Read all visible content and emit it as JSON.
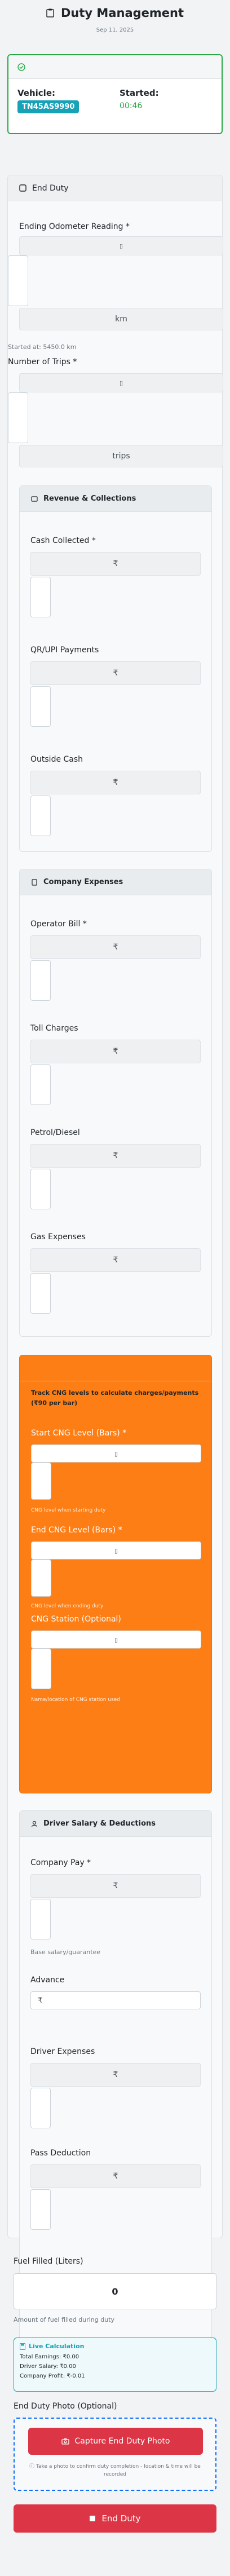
{
  "header": {
    "title": "Duty Management",
    "date": "Sep 11, 2025"
  },
  "vehicle_card": {
    "vehicle_label": "Vehicle:",
    "vehicle_value": "TN45AS9990",
    "started_label": "Started:",
    "started_value": "00:46"
  },
  "end_duty": {
    "title": "End Duty",
    "odometer_label": "Ending Odometer Reading *",
    "odometer_unit": "km",
    "odometer_hint": "Started at: 5450.0 km",
    "trips_label": "Number of Trips *",
    "trips_unit": "trips"
  },
  "revenue": {
    "title": "Revenue & Collections",
    "currency": "₹",
    "cash_label": "Cash Collected *",
    "qr_label": "QR/UPI Payments",
    "outside_label": "Outside Cash"
  },
  "expenses": {
    "title": "Company Expenses",
    "currency": "₹",
    "operator_label": "Operator Bill *",
    "toll_label": "Toll Charges",
    "petrol_label": "Petrol/Diesel",
    "gas_label": "Gas Expenses"
  },
  "cng": {
    "intro": "Track CNG levels to calculate charges/payments (₹90 per bar)",
    "start_label": "Start CNG Level (Bars) *",
    "start_hint": "CNG level when starting duty",
    "end_label": "End CNG Level (Bars) *",
    "end_hint": "CNG level when ending duty",
    "station_label": "CNG Station (Optional)",
    "station_hint": "Name/location of CNG station used"
  },
  "salary": {
    "title": "Driver Salary & Deductions",
    "currency": "₹",
    "company_pay_label": "Company Pay *",
    "company_pay_hint": "Base salary/guarantee",
    "advance_label": "Advance",
    "advance_prefix": "₹",
    "driver_exp_label": "Driver Expenses",
    "pass_label": "Pass Deduction"
  },
  "fuel": {
    "label": "Fuel Filled (Liters)",
    "value": "0",
    "hint": "Amount of fuel filled during duty"
  },
  "live_calc": {
    "title": "Live Calculation",
    "earnings": "Total Earnings: ₹0.00",
    "salary": "Driver Salary: ₹0.00",
    "profit": "Company Profit: ₹-0.01"
  },
  "photo": {
    "label": "End Duty Photo (Optional)",
    "button": "Capture End Duty Photo",
    "hint": "Take a photo to confirm duty completion - location & time will be recorded"
  },
  "submit": {
    "label": "End Duty"
  },
  "colors": {
    "success": "#28a745",
    "info": "#17a2b8",
    "warning": "#fd7e14",
    "danger": "#dc3545"
  }
}
